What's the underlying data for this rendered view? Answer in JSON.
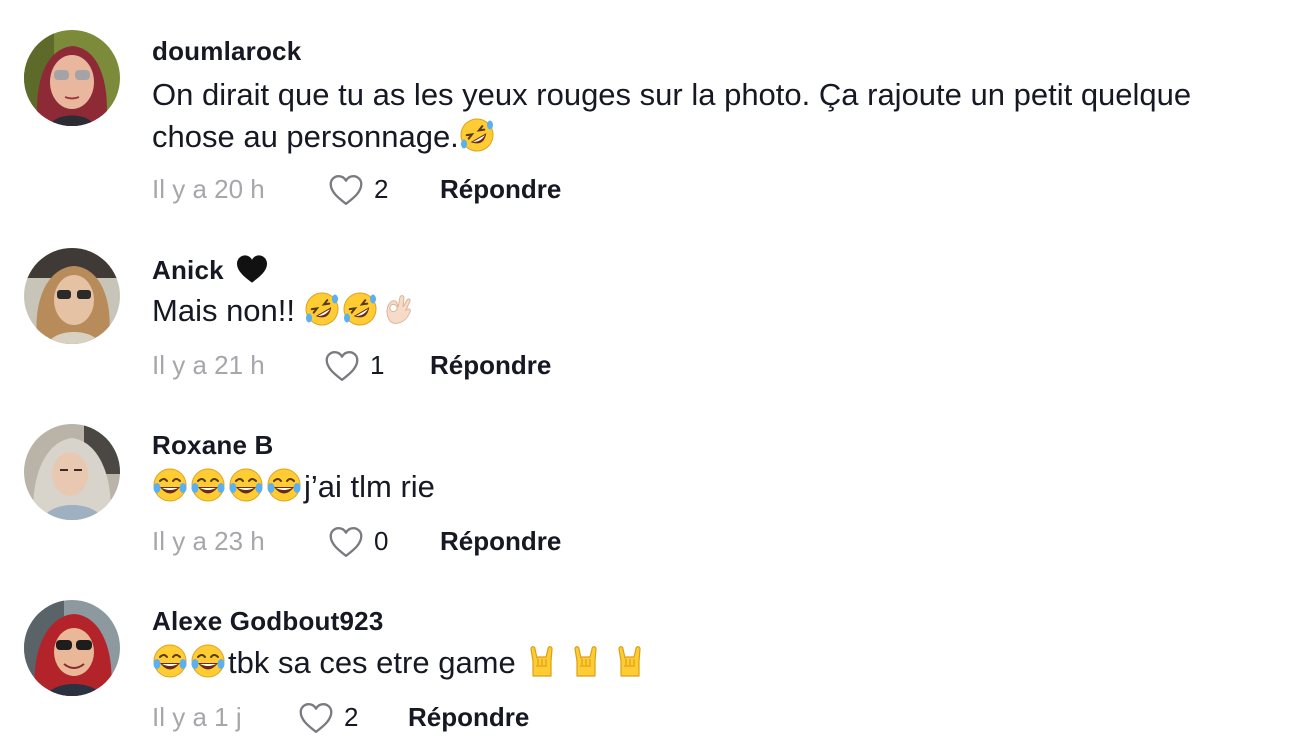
{
  "comments": [
    {
      "username": "doumlarock",
      "text": "On dirait que tu as les yeux rouges sur la photo. Ça rajoute un petit quelque chose au personnage.",
      "text_emojis": [
        "rolling-on-floor-laughing"
      ],
      "time": "Il y a 20 h",
      "likes": "2",
      "reply_label": "Répondre",
      "avatar_icon": "avatar-doumlarock"
    },
    {
      "username": "Anick",
      "username_emoji": "black-heart",
      "text": "Mais non!! ",
      "text_emojis": [
        "rolling-on-floor-laughing",
        "rolling-on-floor-laughing",
        "ok-hand"
      ],
      "time": "Il y a 21 h",
      "likes": "1",
      "reply_label": "Répondre",
      "avatar_icon": "avatar-anick"
    },
    {
      "username": "Roxane B",
      "text_emojis_before": [
        "face-with-tears-of-joy",
        "face-with-tears-of-joy",
        "face-with-tears-of-joy",
        "face-with-tears-of-joy"
      ],
      "text": "j’ai tlm rie",
      "time": "Il y a 23 h",
      "likes": "0",
      "reply_label": "Répondre",
      "avatar_icon": "avatar-roxane"
    },
    {
      "username": "Alexe Godbout923",
      "text_emojis_before": [
        "face-with-tears-of-joy",
        "face-with-tears-of-joy"
      ],
      "text": "tbk sa ces etre game ",
      "text_emojis": [
        "sign-of-horns",
        "sign-of-horns",
        "sign-of-horns"
      ],
      "time": "Il y a 1 j",
      "likes": "2",
      "reply_label": "Répondre",
      "avatar_icon": "avatar-alexe"
    }
  ],
  "colors": {
    "text": "#161823",
    "muted": "#a6a7ab",
    "background": "#ffffff"
  }
}
